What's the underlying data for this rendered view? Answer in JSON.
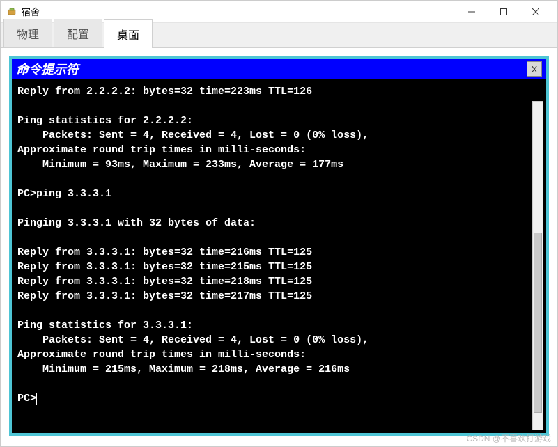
{
  "window": {
    "title": "宿舍",
    "controls": {
      "min": "—",
      "max": "□",
      "close": "×"
    }
  },
  "tabs": [
    {
      "label": "物理",
      "active": false
    },
    {
      "label": "配置",
      "active": false
    },
    {
      "label": "桌面",
      "active": true
    }
  ],
  "terminal": {
    "title": "命令提示符",
    "close_label": "X",
    "lines": [
      "Reply from 2.2.2.2: bytes=32 time=223ms TTL=126",
      "",
      "Ping statistics for 2.2.2.2:",
      "    Packets: Sent = 4, Received = 4, Lost = 0 (0% loss),",
      "Approximate round trip times in milli-seconds:",
      "    Minimum = 93ms, Maximum = 233ms, Average = 177ms",
      "",
      "PC>ping 3.3.3.1",
      "",
      "Pinging 3.3.3.1 with 32 bytes of data:",
      "",
      "Reply from 3.3.3.1: bytes=32 time=216ms TTL=125",
      "Reply from 3.3.3.1: bytes=32 time=215ms TTL=125",
      "Reply from 3.3.3.1: bytes=32 time=218ms TTL=125",
      "Reply from 3.3.3.1: bytes=32 time=217ms TTL=125",
      "",
      "Ping statistics for 3.3.3.1:",
      "    Packets: Sent = 4, Received = 4, Lost = 0 (0% loss),",
      "Approximate round trip times in milli-seconds:",
      "    Minimum = 215ms, Maximum = 218ms, Average = 216ms",
      "",
      "PC>"
    ]
  },
  "watermark": "CSDN @不喜欢打游戏"
}
